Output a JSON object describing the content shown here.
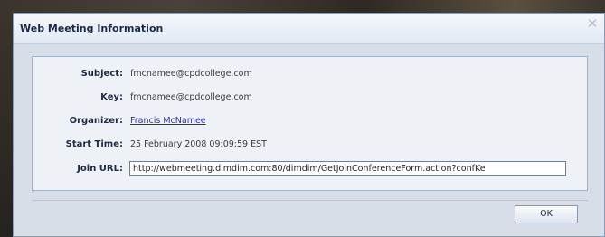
{
  "dialog": {
    "title": "Web Meeting Information",
    "close_glyph": "✕"
  },
  "fields": {
    "subject": {
      "label": "Subject:",
      "value": "fmcnamee@cpdcollege.com"
    },
    "key": {
      "label": "Key:",
      "value": "fmcnamee@cpdcollege.com"
    },
    "organizer": {
      "label": "Organizer:",
      "value": "Francis McNamee"
    },
    "start_time": {
      "label": "Start Time:",
      "value": "25 February 2008 09:09:59 EST"
    },
    "join_url": {
      "label": "Join URL:",
      "value": "http://webmeeting.dimdim.com:80/dimdim/GetJoinConferenceForm.action?confKe"
    }
  },
  "buttons": {
    "ok_label": "OK"
  },
  "icons": {
    "close": "close-icon"
  },
  "colors": {
    "title_text": "#1a2a4a",
    "link": "#2b2bb8",
    "panel_border": "#9fb2cc"
  }
}
